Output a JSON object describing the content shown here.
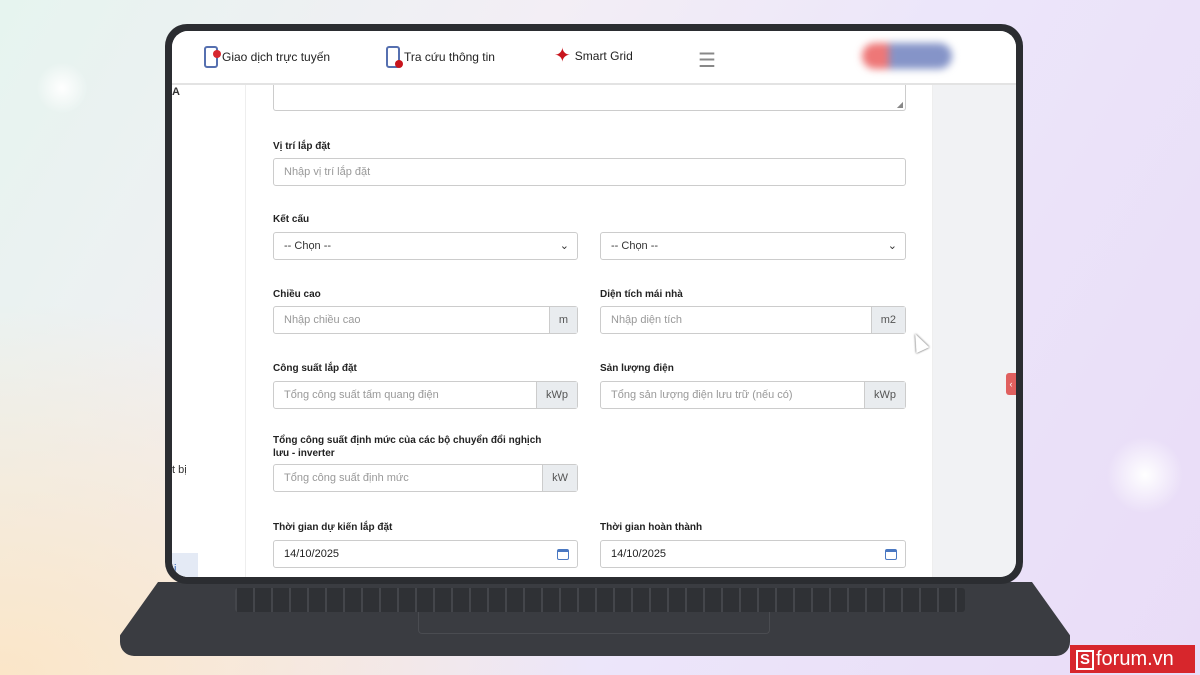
{
  "header": {
    "nav": [
      {
        "label": "Giao dịch trực tuyến",
        "icon": "phone-alert-icon"
      },
      {
        "label": "Tra cứu thông tin",
        "icon": "document-search-icon"
      },
      {
        "label": "Smart Grid",
        "icon": "star-icon"
      }
    ]
  },
  "sidebar": {
    "fragments": [
      "A",
      "t bị",
      "i"
    ]
  },
  "form": {
    "location": {
      "label": "Vị trí lắp đặt",
      "placeholder": "Nhập vị trí lắp đặt"
    },
    "structure": {
      "label": "Kết cấu",
      "select1": "-- Chọn --",
      "select2": "-- Chọn --"
    },
    "height": {
      "label": "Chiều cao",
      "placeholder": "Nhập chiều cao",
      "unit": "m"
    },
    "roof_area": {
      "label": "Diện tích mái nhà",
      "placeholder": "Nhập diện tích",
      "unit": "m2"
    },
    "capacity": {
      "label": "Công suất lắp đặt",
      "placeholder": "Tổng công suất tấm quang điện",
      "unit": "kWp"
    },
    "output": {
      "label": "Sản lượng điện",
      "placeholder": "Tổng sản lượng điện lưu trữ (nếu có)",
      "unit": "kWp"
    },
    "inverter": {
      "label": "Tổng công suất định mức của các bộ chuyển đổi nghịch lưu - inverter",
      "placeholder": "Tổng công suất định mức",
      "unit": "kW"
    },
    "start_date": {
      "label": "Thời gian dự kiến lắp đặt",
      "value": "14/10/2025"
    },
    "end_date": {
      "label": "Thời gian hoàn thành",
      "value": "14/10/2025"
    }
  },
  "watermark": {
    "brand": "forum.vn",
    "mark": "S"
  }
}
